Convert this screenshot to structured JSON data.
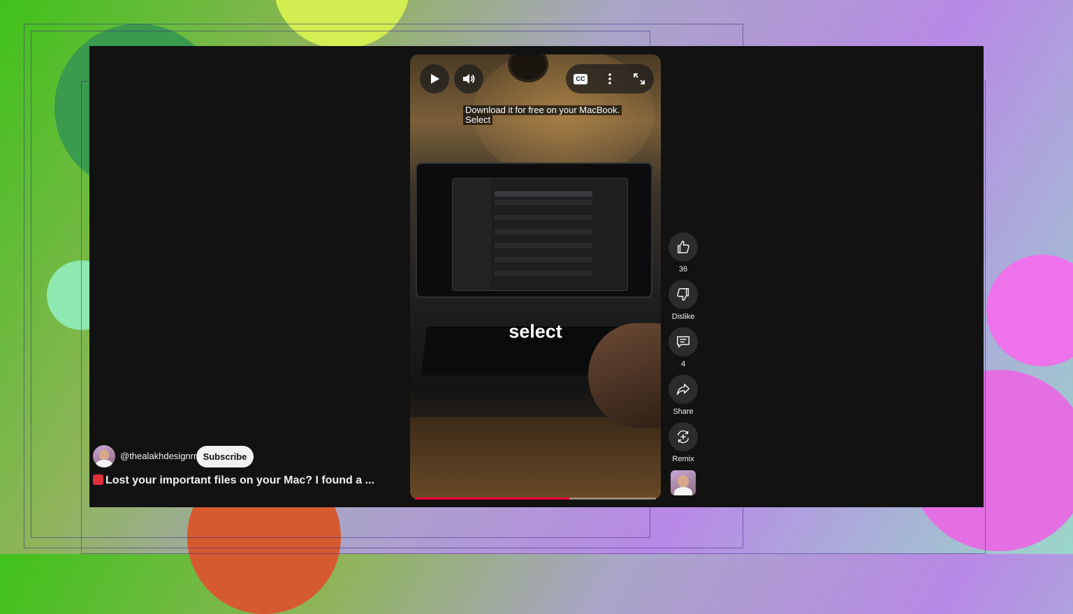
{
  "player": {
    "caption_line1": "Download it for free on your MacBook.",
    "caption_line2": "Select",
    "overlay_text": "select",
    "progress_fraction": 0.64,
    "controls": {
      "play_icon": "play-icon",
      "volume_icon": "volume-icon",
      "cc_label": "CC",
      "more_icon": "more-vert-icon",
      "fullscreen_icon": "fullscreen-icon"
    }
  },
  "actions": [
    {
      "name": "like",
      "icon": "thumbs-up-icon",
      "label": "36"
    },
    {
      "name": "dislike",
      "icon": "thumbs-down-icon",
      "label": "Dislike"
    },
    {
      "name": "comments",
      "icon": "comment-icon",
      "label": "4"
    },
    {
      "name": "share",
      "icon": "share-icon",
      "label": "Share"
    },
    {
      "name": "remix",
      "icon": "remix-icon",
      "label": "Remix"
    }
  ],
  "channel": {
    "handle": "@thealakhdesignrr",
    "subscribe_label": "Subscribe"
  },
  "video": {
    "title": "Lost your important files on your Mac? I found a ..."
  },
  "colors": {
    "panel_bg": "#121212",
    "progress": "#ff0033",
    "button_bg": "#2c2c2c"
  }
}
